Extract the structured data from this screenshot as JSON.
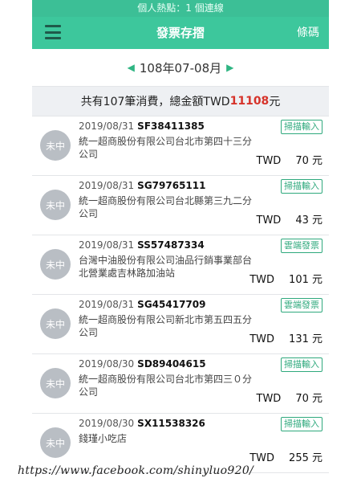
{
  "status_bar": {
    "text": "個人熱點：1 個連線"
  },
  "navbar": {
    "title": "發票存摺",
    "right_label": "條碼",
    "menu_icon": "hamburger-menu-icon"
  },
  "period": {
    "label": "108年07-08月",
    "prev_icon": "triangle-left-icon",
    "next_icon": "triangle-right-icon"
  },
  "summary": {
    "prefix": "共有107筆消費，總金額TWD",
    "amount": "11108",
    "suffix": "元"
  },
  "invoices": [
    {
      "status": "未中",
      "date": "2019/08/31",
      "number": "SF38411385",
      "tag": "掃描輸入",
      "store": "統一超商股份有限公司台北市第四十三分公司",
      "currency": "TWD",
      "amount": "70 元"
    },
    {
      "status": "未中",
      "date": "2019/08/31",
      "number": "SG79765111",
      "tag": "掃描輸入",
      "store": "統一超商股份有限公司台北縣第三九二分公司",
      "currency": "TWD",
      "amount": "43 元"
    },
    {
      "status": "未中",
      "date": "2019/08/31",
      "number": "SS57487334",
      "tag": "雲端發票",
      "store": "台灣中油股份有限公司油品行銷事業部台北營業處吉林路加油站",
      "currency": "TWD",
      "amount": "101 元"
    },
    {
      "status": "未中",
      "date": "2019/08/31",
      "number": "SG45417709",
      "tag": "雲端發票",
      "store": "統一超商股份有限公司新北市第五四五分公司",
      "currency": "TWD",
      "amount": "131 元"
    },
    {
      "status": "未中",
      "date": "2019/08/30",
      "number": "SD89404615",
      "tag": "掃描輸入",
      "store": "統一超商股份有限公司台北市第四三０分公司",
      "currency": "TWD",
      "amount": "70 元"
    },
    {
      "status": "未中",
      "date": "2019/08/30",
      "number": "SX11538326",
      "tag": "掃描輸入",
      "store": "錢瑾小吃店",
      "currency": "TWD",
      "amount": "255 元"
    }
  ],
  "watermark": {
    "text": "https://www.facebook.com/shinyluo920/"
  },
  "colors": {
    "accent": "#3dc79c",
    "amount_red": "#d6332a",
    "tag_green": "#2fa97d"
  }
}
